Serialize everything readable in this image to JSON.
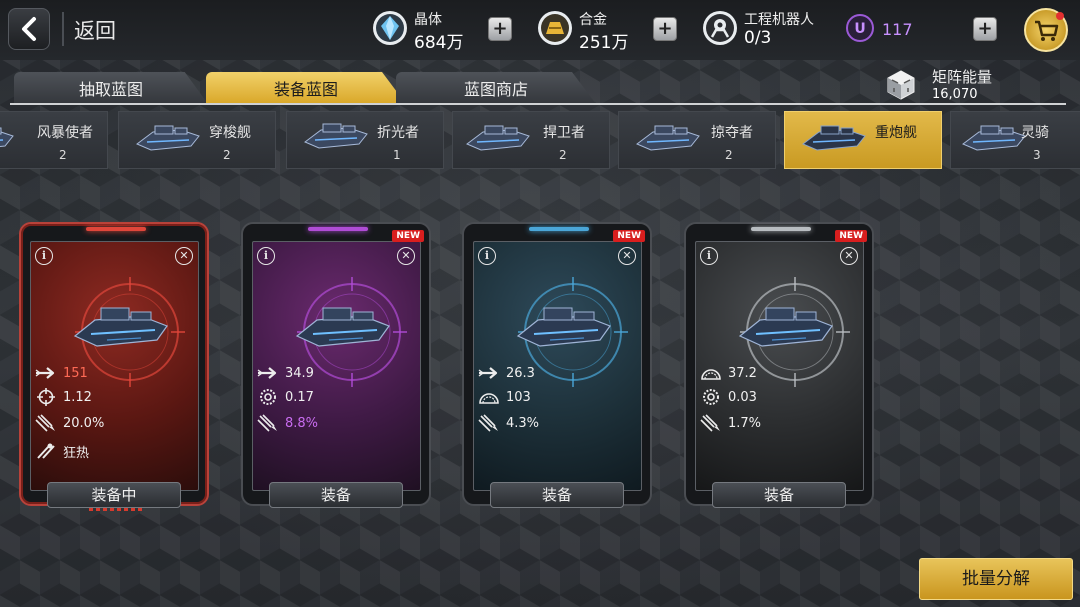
{
  "header": {
    "back_label": "返回",
    "resources": [
      {
        "name": "晶体",
        "value": "684万",
        "icon": "crystal-icon"
      },
      {
        "name": "合金",
        "value": "251万",
        "icon": "alloy-icon"
      },
      {
        "name": "工程机器人",
        "value": "0/3",
        "icon": "robot-icon"
      }
    ],
    "premium": {
      "icon": "u-currency-icon",
      "value": "117"
    },
    "plus_label": "+"
  },
  "tabs": [
    {
      "label": "抽取蓝图",
      "active": false
    },
    {
      "label": "装备蓝图",
      "active": true
    },
    {
      "label": "蓝图商店",
      "active": false
    }
  ],
  "matrix": {
    "name": "矩阵能量",
    "value": "16,070",
    "icon": "matrix-cube-icon"
  },
  "ships": [
    {
      "name": "风暴使者",
      "count": "2",
      "active": false
    },
    {
      "name": "穿梭舰",
      "count": "2",
      "active": false
    },
    {
      "name": "折光者",
      "count": "1",
      "active": false
    },
    {
      "name": "捍卫者",
      "count": "2",
      "active": false
    },
    {
      "name": "掠夺者",
      "count": "2",
      "active": false
    },
    {
      "name": "重炮舰",
      "count": "",
      "active": true
    },
    {
      "name": "灵骑",
      "count": "3",
      "active": false
    }
  ],
  "cards": [
    {
      "theme": "red",
      "accent": "#e0463a",
      "new": "",
      "stats": [
        {
          "icon": "attack-arrow-icon",
          "value": "151",
          "color": "#ff6a55"
        },
        {
          "icon": "crosshair-icon",
          "value": "1.12",
          "color": "#f0f0f0"
        },
        {
          "icon": "missile-icon",
          "value": "20.0%",
          "color": "#f0f0f0"
        },
        {
          "icon": "frenzy-icon",
          "value": "狂热",
          "color": "#f0f0f0"
        }
      ],
      "button": "装备中"
    },
    {
      "theme": "purple",
      "accent": "#b04cd6",
      "new": "NEW",
      "stats": [
        {
          "icon": "attack-arrow-icon",
          "value": "34.9",
          "color": "#f0f0f0"
        },
        {
          "icon": "gear-icon",
          "value": "0.17",
          "color": "#f0f0f0"
        },
        {
          "icon": "missile-icon",
          "value": "8.8%",
          "color": "#c86cf0"
        }
      ],
      "button": "装备"
    },
    {
      "theme": "blue",
      "accent": "#4aa6d8",
      "new": "NEW",
      "stats": [
        {
          "icon": "attack-arrow-icon",
          "value": "26.3",
          "color": "#f0f0f0"
        },
        {
          "icon": "shield-dome-icon",
          "value": "103",
          "color": "#f0f0f0"
        },
        {
          "icon": "missile-icon",
          "value": "4.3%",
          "color": "#f0f0f0"
        }
      ],
      "button": "装备"
    },
    {
      "theme": "gray",
      "accent": "#b8bcc0",
      "new": "NEW",
      "stats": [
        {
          "icon": "shield-dome-icon",
          "value": "37.2",
          "color": "#f0f0f0"
        },
        {
          "icon": "gear-icon",
          "value": "0.03",
          "color": "#f0f0f0"
        },
        {
          "icon": "missile-icon",
          "value": "1.7%",
          "color": "#f0f0f0"
        }
      ],
      "button": "装备"
    }
  ],
  "bottom": {
    "batch_label": "批量分解"
  },
  "card_info_label": "i",
  "card_close_label": "✕"
}
